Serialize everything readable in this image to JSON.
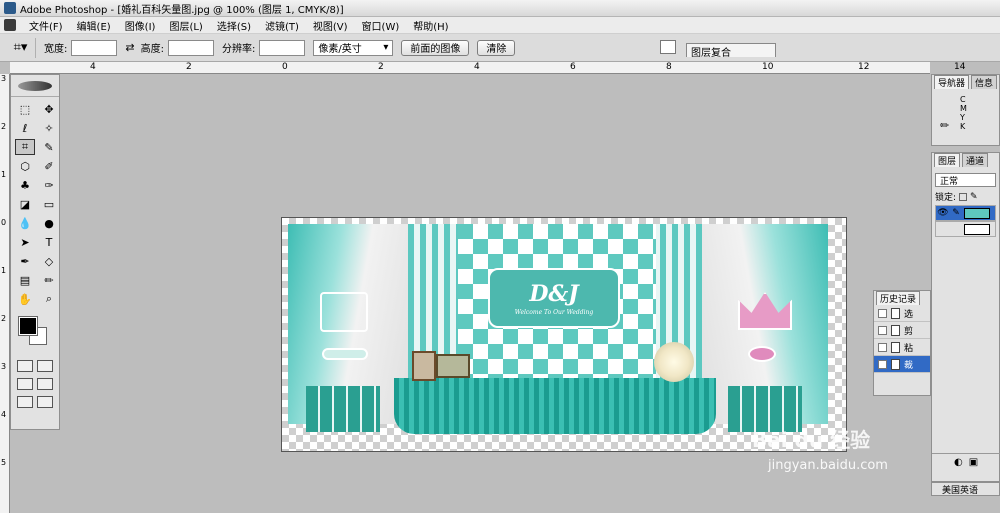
{
  "titlebar": {
    "title": "Adobe Photoshop - [婚礼百科矢量图.jpg @ 100% (图层 1, CMYK/8)]"
  },
  "menu": [
    "文件(F)",
    "编辑(E)",
    "图像(I)",
    "图层(L)",
    "选择(S)",
    "滤镜(T)",
    "视图(V)",
    "窗口(W)",
    "帮助(H)"
  ],
  "options": {
    "width_label": "宽度:",
    "height_label": "高度:",
    "resolution_label": "分辨率:",
    "unit": "像素/英寸",
    "front_image_btn": "前面的图像",
    "clear_btn": "清除",
    "layer_comps_tab": "图层复合"
  },
  "ruler": {
    "h_labels": [
      "4",
      "2",
      "0",
      "2",
      "4",
      "6",
      "8",
      "10",
      "12",
      "14"
    ],
    "v_labels": [
      "3",
      "2",
      "1",
      "0",
      "1",
      "2",
      "3",
      "4",
      "5"
    ]
  },
  "canvas": {
    "monogram": "D&J",
    "subtitle": "Welcome To Our Wedding"
  },
  "navigator": {
    "tabs": [
      "导航器",
      "信息"
    ],
    "cmyk": [
      "C",
      "M",
      "Y",
      "K"
    ]
  },
  "layers": {
    "tabs": [
      "图层",
      "通道"
    ],
    "blend_mode": "正常",
    "lock_label": "锁定:"
  },
  "history": {
    "title": "历史记录",
    "items": [
      "选",
      "剪",
      "粘",
      "裁"
    ]
  },
  "status": {
    "language": "美国英语"
  },
  "watermark": {
    "text": "Bai du 经验",
    "url": "jingyan.baidu.com"
  }
}
